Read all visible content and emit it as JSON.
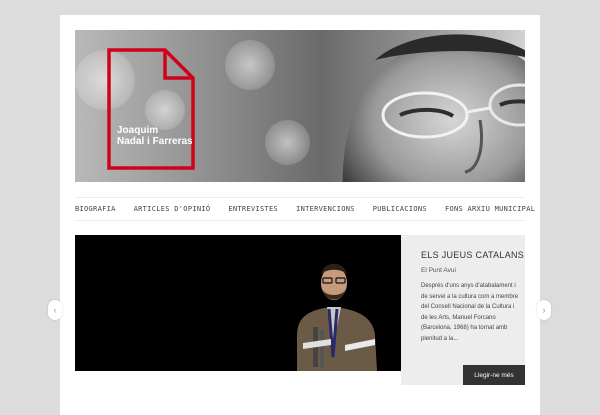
{
  "header": {
    "logo_line1": "Joaquim",
    "logo_line2": "Nadal i Farreras",
    "accent_color": "#d0021b"
  },
  "nav": {
    "items": [
      {
        "label": "BIOGRAFIA"
      },
      {
        "label": "ARTICLES D'OPINIÓ"
      },
      {
        "label": "ENTREVISTES"
      },
      {
        "label": "INTERVENCIONS"
      },
      {
        "label": "PUBLICACIONS"
      },
      {
        "label": "FONS ARXIU MUNICIPAL"
      }
    ]
  },
  "slider": {
    "title": "ELS JUEUS CATALANS",
    "source": "El Punt Avui",
    "excerpt": "Després d'uns anys d'atabalament i de servei a la cultura com a membre del Consell Nacional de la Cultura i de les Arts, Manuel Forcano (Barcelona, 1968) ha tornat amb plenitud a la...",
    "read_more": "Llegir-ne més",
    "prev_icon": "chevron-left-icon",
    "next_icon": "chevron-right-icon"
  }
}
